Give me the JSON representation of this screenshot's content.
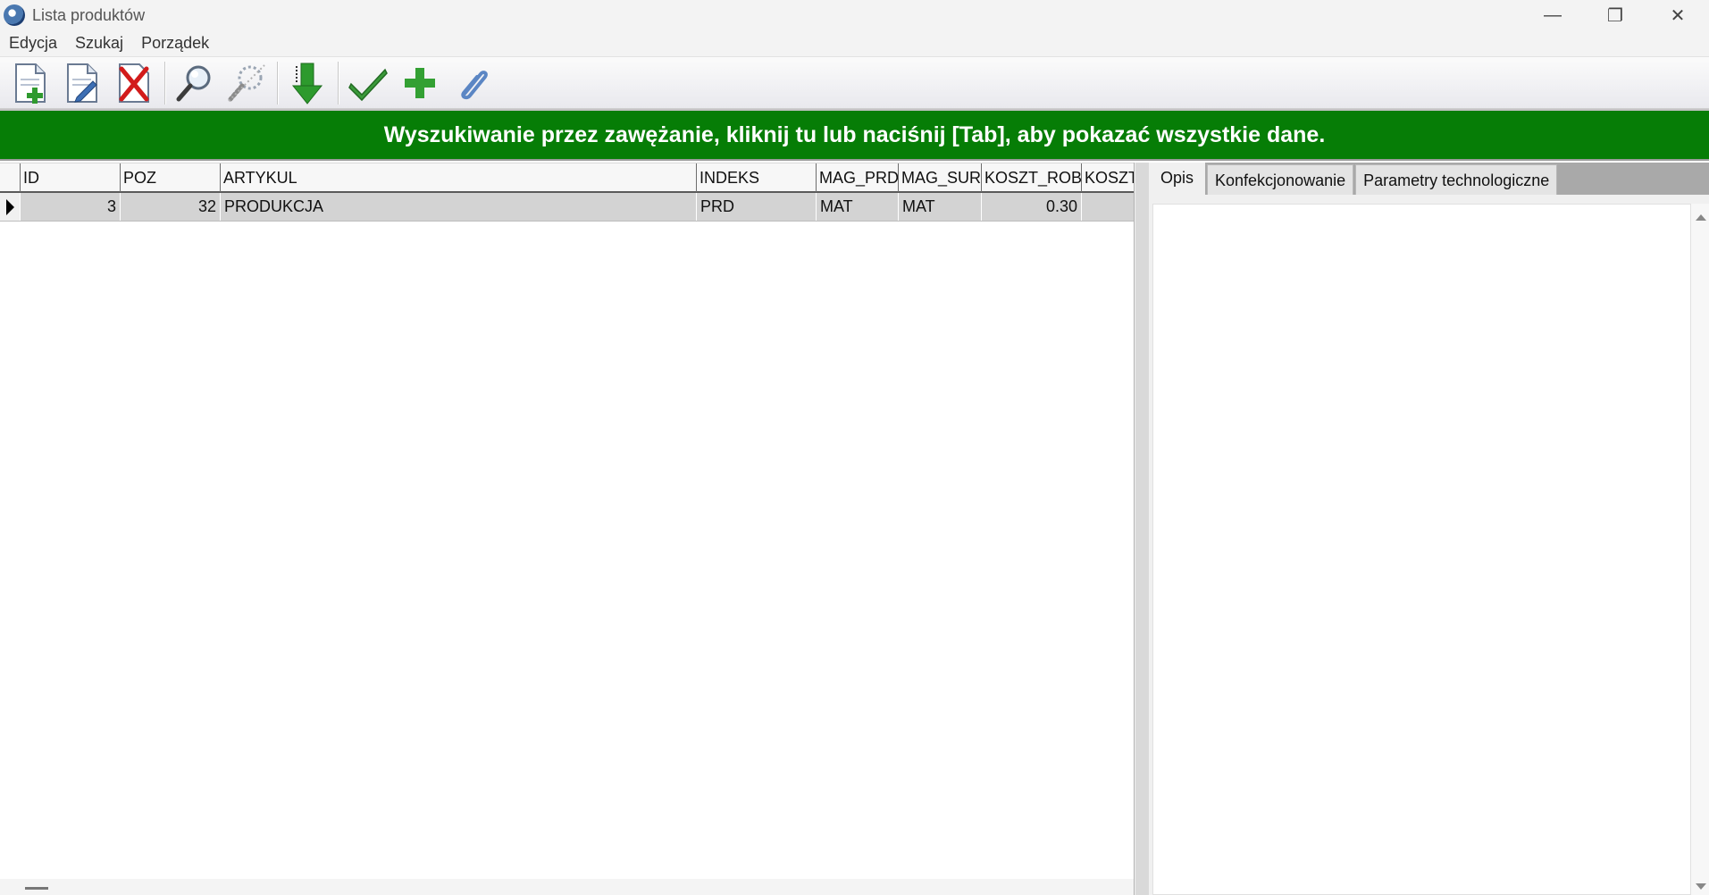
{
  "window": {
    "title": "Lista produktów",
    "controls": {
      "minimize": "—",
      "maximize": "❐",
      "close": "✕"
    }
  },
  "menu": {
    "items": [
      "Edycja",
      "Szukaj",
      "Porządek"
    ]
  },
  "toolbar": {
    "buttons": [
      "add-document-icon",
      "edit-document-icon",
      "delete-icon",
      "search-icon",
      "search-clear-icon",
      "sort-down-icon",
      "accept-icon",
      "plus-icon",
      "attachment-icon"
    ]
  },
  "banner": {
    "text": "Wyszukiwanie przez zawężanie, kliknij tu lub naciśnij [Tab], aby pokazać wszystkie dane.",
    "color": "#067d06"
  },
  "grid": {
    "columns": [
      "ID",
      "POZ",
      "ARTYKUL",
      "INDEKS",
      "MAG_PRD",
      "MAG_SUR",
      "KOSZT_ROB",
      "KOSZT"
    ],
    "rows": [
      {
        "id": "3",
        "poz": "32",
        "artykul": "PRODUKCJA",
        "indeks": "PRD",
        "mag_prd": "MAT",
        "mag_sur": "MAT",
        "koszt_rob": "0.30",
        "koszt": ""
      }
    ]
  },
  "panel": {
    "tabs": [
      "Opis",
      "Konfekcjonowanie",
      "Parametry technologiczne"
    ],
    "active_tab": "Opis"
  }
}
